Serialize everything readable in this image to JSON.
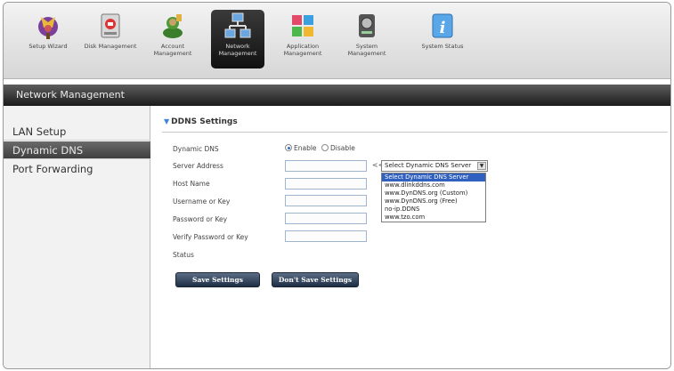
{
  "toolbar": {
    "items": [
      {
        "label": "Setup Wizard",
        "icon": "wizard-icon"
      },
      {
        "label": "Disk Management",
        "icon": "disk-icon"
      },
      {
        "label": "Account Management",
        "icon": "account-icon"
      },
      {
        "label": "Network Management",
        "icon": "network-icon"
      },
      {
        "label": "Application Management",
        "icon": "application-icon"
      },
      {
        "label": "System Management",
        "icon": "system-icon"
      },
      {
        "label": "System Status",
        "icon": "info-icon"
      }
    ],
    "active_index": 3
  },
  "title_bar": {
    "text": "Network Management"
  },
  "sidebar": {
    "items": [
      {
        "label": "LAN Setup"
      },
      {
        "label": "Dynamic DNS"
      },
      {
        "label": "Port Forwarding"
      }
    ],
    "active_index": 1
  },
  "ddns": {
    "section_title": "DDNS Settings",
    "labels": {
      "dynamic_dns": "Dynamic DNS",
      "server_address": "Server Address",
      "host_name": "Host Name",
      "username": "Username or Key",
      "password": "Password or Key",
      "verify_password": "Verify Password or Key",
      "status": "Status"
    },
    "radio": {
      "enable": "Enable",
      "disable": "Disable",
      "selected": "enable"
    },
    "arrows": "<<",
    "server_select": {
      "value": "Select Dynamic DNS Server",
      "options": [
        "Select Dynamic DNS Server",
        "www.dlinkddns.com",
        "www.DynDNS.org (Custom)",
        "www.DynDNS.org (Free)",
        "no-ip.DDNS",
        "www.tzo.com"
      ],
      "highlighted_index": 0
    },
    "buttons": {
      "save": "Save Settings",
      "dont_save": "Don't Save Settings"
    }
  },
  "colors": {
    "accent_blue": "#3a85d6",
    "active_tab_bg": "#1b1b1b",
    "selection_blue": "#3060c0",
    "button_navy": "#1d2d44"
  }
}
